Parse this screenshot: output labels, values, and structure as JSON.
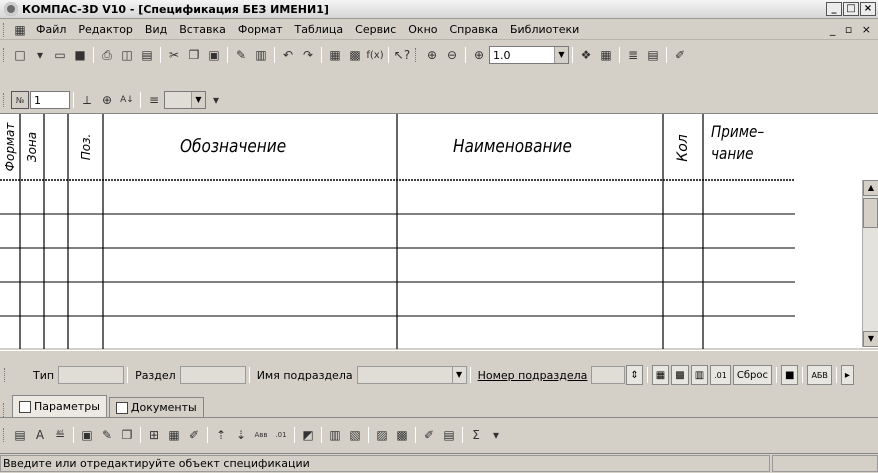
{
  "window": {
    "title": "КОМПАС-3D V10 - [Спецификация БЕЗ ИМЕНИ1]",
    "min": "_",
    "max": "□",
    "close": "×"
  },
  "menu": {
    "items": [
      "Файл",
      "Редактор",
      "Вид",
      "Вставка",
      "Формат",
      "Таблица",
      "Сервис",
      "Окно",
      "Справка",
      "Библиотеки"
    ],
    "mdi": "_ ▫ ×"
  },
  "toolbar_main": {
    "zoom_value": "1.0"
  },
  "toolbar_spec": {
    "number_value": "1"
  },
  "spec_table": {
    "columns": {
      "format": "Формат",
      "zone": "Зона",
      "pos": "Поз.",
      "designation": "Обозначение",
      "name": "Наименование",
      "qty": "Кол",
      "note_line1": "Приме–",
      "note_line2": "чание"
    },
    "row_count": 6
  },
  "properties": {
    "type_label": "Тип",
    "section_label": "Раздел",
    "subsection_name_label": "Имя подраздела",
    "subsection_number_label": "Номер подраздела",
    "reset_label": "Сброс"
  },
  "tabs": {
    "params": "Параметры",
    "docs": "Документы"
  },
  "status": {
    "text": "Введите или отредактируйте объект спецификации"
  },
  "colors": {
    "chrome": "#d4d0c8",
    "page": "#ffffff",
    "lines": "#000000"
  }
}
